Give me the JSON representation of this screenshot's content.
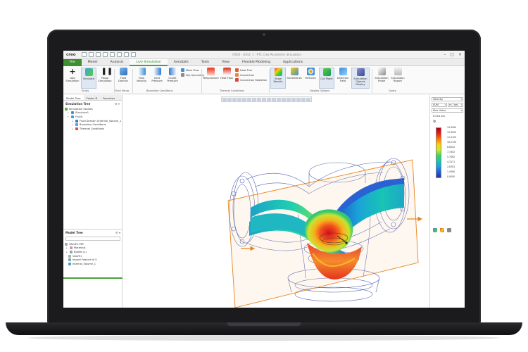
{
  "app": {
    "brand": "creo",
    "window_title": "CREO - GOLF_1 - PTC Creo Parametric Simulation"
  },
  "tabs": [
    "File",
    "Model",
    "Analysis",
    "Live Simulation",
    "Annotate",
    "Tools",
    "View",
    "Flexible Modeling",
    "Applications"
  ],
  "active_tab": "Live Simulation",
  "ribbon": {
    "study": {
      "group_label": "Study",
      "add_simulation": "Add Simulation",
      "simulate": "Simulate",
      "pause_simulation": "Pause Simulation"
    },
    "fluid_setup": {
      "group_label": "Fluid Setup",
      "fluid_domain": "Fluid Domain"
    },
    "boundary_conditions": {
      "group_label": "Boundary Conditions",
      "flow_velocity": "Flow Velocity",
      "inlet_pressure": "Inlet Pressure",
      "outlet_pressure": "Outlet Pressure",
      "mass_flow": "Mass Flow",
      "slip_symmetry": "Slip Symmetry"
    },
    "thermal_conditions": {
      "group_label": "Thermal Conditions",
      "temperature": "Temperature",
      "heat_flow": "Heat Flow",
      "heat_flux": "Heat Flux",
      "convection": "Convection",
      "convection_radiation": "Convection Radiation"
    },
    "display_options": {
      "group_label": "Display Options",
      "show_results": "Show Results",
      "streamlines": "Streamlines",
      "particles": "Particles",
      "cut_plane": "Cut Plane",
      "direction_field": "Direction Field",
      "simulation_objects_display": "Simulation Objects Display"
    },
    "query": {
      "group_label": "Query",
      "simulation_probe": "Simulation Probe",
      "simulation_report": "Simulation Report"
    }
  },
  "left_panel": {
    "tabs": [
      "Model Tree",
      "Folder B",
      "Favorites"
    ],
    "sim_tree": {
      "title": "Simulation Tree",
      "items": [
        {
          "label": "Simulation Studies",
          "level": 0
        },
        {
          "label": "Structure1",
          "level": 1
        },
        {
          "label": "Fluid1",
          "level": 1
        },
        {
          "label": "Fluid Domain (Internal_Volume_1",
          "level": 2
        },
        {
          "label": "Boundary Conditions",
          "level": 2
        },
        {
          "label": "Thermal Conditions",
          "level": 2
        }
      ]
    },
    "model_tree": {
      "title": "Model Tree",
      "items": [
        {
          "label": "VALVE1.PRT",
          "level": 0
        },
        {
          "label": "Materials",
          "level": 1
        },
        {
          "label": "Bodies (1)",
          "level": 1
        },
        {
          "label": "VALVE1",
          "level": 1
        },
        {
          "label": "Import Feature id 5",
          "level": 1
        },
        {
          "label": "Internal_Volume_1",
          "level": 1
        }
      ]
    }
  },
  "right_panel": {
    "quantity": "Velocity",
    "component": "SUM",
    "units": "m / sec",
    "range_mode": "Max Value",
    "max_text": "0.001 sec",
    "legend_ticks": [
      "14.3904",
      "12.9505",
      "11.5123",
      "10.0733",
      "8.6342",
      "7.1952",
      "5.7562",
      "4.3171",
      "2.8781",
      "1.4390",
      "0.0000"
    ],
    "legend_colors": [
      "#b50010",
      "#2032a8"
    ]
  },
  "viewport": {
    "colors": {
      "accent": "#4aa03a",
      "orange_plane": "#e8821e",
      "wireframe": "#3a4aa8"
    }
  }
}
